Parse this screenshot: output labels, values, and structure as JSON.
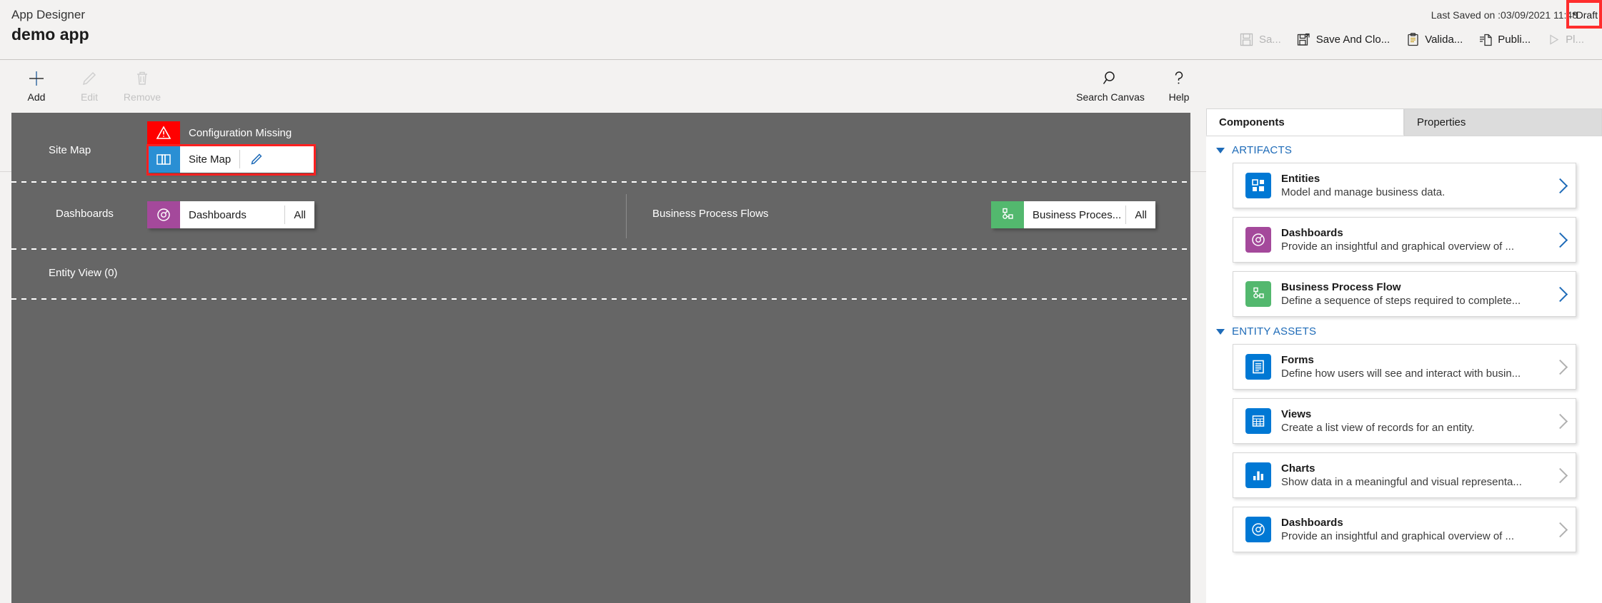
{
  "header": {
    "product": "App Designer",
    "app_name": "demo app",
    "last_saved": "Last Saved on :03/09/2021 11:48",
    "draft_badge": "*Draft",
    "commands": [
      {
        "label": "Sa...",
        "icon": "save-icon",
        "disabled": true
      },
      {
        "label": "Save And Clo...",
        "icon": "save-and-close-icon",
        "disabled": false
      },
      {
        "label": "Valida...",
        "icon": "validate-clipboard-icon",
        "disabled": false
      },
      {
        "label": "Publi...",
        "icon": "publish-icon",
        "disabled": false
      },
      {
        "label": "Pl...",
        "icon": "play-icon",
        "disabled": true
      }
    ]
  },
  "toolbar": {
    "left_buttons": [
      {
        "label": "Add",
        "icon": "plus-icon",
        "disabled": false
      },
      {
        "label": "Edit",
        "icon": "pencil-icon",
        "disabled": true
      },
      {
        "label": "Remove",
        "icon": "trash-icon",
        "disabled": true
      }
    ],
    "right_buttons": [
      {
        "label": "Search Canvas",
        "icon": "magnifier-icon",
        "disabled": false
      },
      {
        "label": "Help",
        "icon": "question-mark-icon",
        "disabled": false
      }
    ]
  },
  "canvas": {
    "sitemap_row": {
      "label": "Site Map",
      "warning": "Configuration Missing",
      "tile_name": "Site Map",
      "tile_icon": "sitemap-book-icon",
      "edit_icon": "pencil-icon",
      "tile_icon_color": "#2a8fd4",
      "warning_color": "#ff0000",
      "highlight_color": "#ff2020"
    },
    "dashboards_row": {
      "label": "Dashboards",
      "tile_name": "Dashboards",
      "tile_badge": "All",
      "tile_icon": "dashboard-gauge-icon",
      "tile_icon_color": "#a4499b"
    },
    "bpf_row": {
      "label": "Business Process Flows",
      "tile_name": "Business Proces...",
      "tile_badge": "All",
      "tile_icon": "process-flow-icon",
      "tile_icon_color": "#53b86e"
    },
    "entity_row": {
      "label": "Entity View (0)"
    }
  },
  "right_panel": {
    "tabs": [
      {
        "label": "Components",
        "active": true
      },
      {
        "label": "Properties",
        "active": false
      }
    ],
    "sections": [
      {
        "title": "ARTIFACTS",
        "cards": [
          {
            "title": "Entities",
            "desc": "Model and manage business data.",
            "icon": "entities-grid-icon",
            "color": "#0078d4",
            "chev_dim": false
          },
          {
            "title": "Dashboards",
            "desc": "Provide an insightful and graphical overview of ...",
            "icon": "dashboard-gauge-icon",
            "color": "#a4499b",
            "chev_dim": false
          },
          {
            "title": "Business Process Flow",
            "desc": "Define a sequence of steps required to complete...",
            "icon": "process-flow-icon",
            "color": "#53b86e",
            "chev_dim": false
          }
        ]
      },
      {
        "title": "ENTITY ASSETS",
        "cards": [
          {
            "title": "Forms",
            "desc": "Define how users will see and interact with busin...",
            "icon": "form-document-icon",
            "color": "#0078d4",
            "chev_dim": true
          },
          {
            "title": "Views",
            "desc": "Create a list view of records for an entity.",
            "icon": "views-table-icon",
            "color": "#0078d4",
            "chev_dim": true
          },
          {
            "title": "Charts",
            "desc": "Show data in a meaningful and visual representa...",
            "icon": "chart-bar-icon",
            "color": "#0078d4",
            "chev_dim": true
          },
          {
            "title": "Dashboards",
            "desc": "Provide an insightful and graphical overview of ...",
            "icon": "dashboard-gauge-icon",
            "color": "#0078d4",
            "chev_dim": true
          }
        ]
      }
    ]
  }
}
